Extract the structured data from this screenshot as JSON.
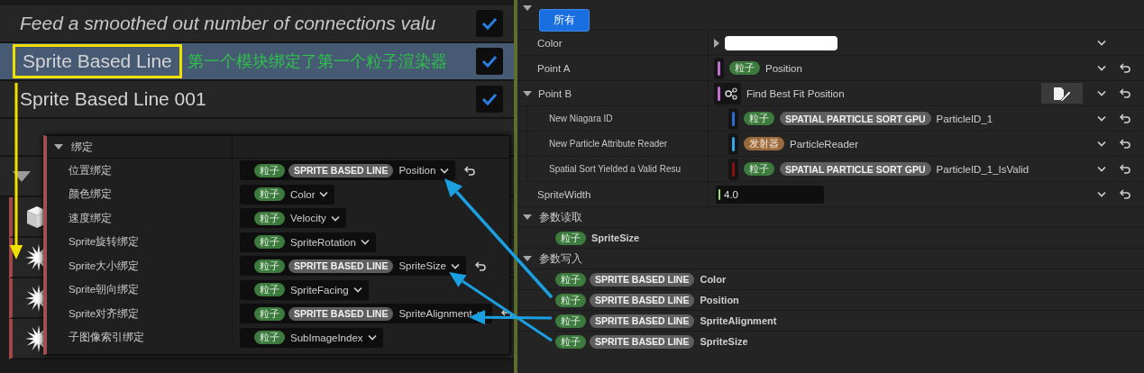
{
  "emitter_list": {
    "items": [
      {
        "text": "Feed a smoothed out number of connections valu",
        "kind": "comment",
        "selected": false,
        "checked": true,
        "annotated": false
      },
      {
        "text": "Sprite Based Line",
        "kind": "renderer",
        "selected": true,
        "checked": true,
        "annotated": true
      },
      {
        "text": "Sprite Based Line 001",
        "kind": "renderer",
        "selected": false,
        "checked": true,
        "annotated": false
      }
    ]
  },
  "annotation": {
    "note": "第一个模块绑定了第一个粒子渲染器"
  },
  "bindings_popup": {
    "title": "绑定",
    "expanded": true,
    "rows": [
      {
        "label": "位置绑定",
        "tags": [
          {
            "text": "粒子",
            "kind": "particle"
          },
          {
            "text": "SPRITE BASED LINE",
            "kind": "module"
          }
        ],
        "value": "Position",
        "reset": true
      },
      {
        "label": "颜色绑定",
        "tags": [
          {
            "text": "粒子",
            "kind": "particle"
          }
        ],
        "value": "Color",
        "reset": false
      },
      {
        "label": "速度绑定",
        "tags": [
          {
            "text": "粒子",
            "kind": "particle"
          }
        ],
        "value": "Velocity",
        "reset": false
      },
      {
        "label": "Sprite旋转绑定",
        "tags": [
          {
            "text": "粒子",
            "kind": "particle"
          }
        ],
        "value": "SpriteRotation",
        "reset": false
      },
      {
        "label": "Sprite大小绑定",
        "tags": [
          {
            "text": "粒子",
            "kind": "particle"
          },
          {
            "text": "SPRITE BASED LINE",
            "kind": "module"
          }
        ],
        "value": "SpriteSize",
        "reset": true
      },
      {
        "label": "Sprite朝向绑定",
        "tags": [
          {
            "text": "粒子",
            "kind": "particle"
          }
        ],
        "value": "SpriteFacing",
        "reset": false
      },
      {
        "label": "Sprite对齐绑定",
        "tags": [
          {
            "text": "粒子",
            "kind": "particle"
          },
          {
            "text": "SPRITE BASED LINE",
            "kind": "module"
          }
        ],
        "value": "SpriteAlignment",
        "reset": true
      },
      {
        "label": "子图像索引绑定",
        "tags": [
          {
            "text": "粒子",
            "kind": "particle"
          }
        ],
        "value": "SubImageIndex",
        "reset": false
      }
    ]
  },
  "details": {
    "filter": "所有",
    "expanded": true,
    "properties": [
      {
        "label": "Color",
        "kind": "color",
        "color": "#ffffff",
        "reset": false
      },
      {
        "label": "Point A",
        "kind": "binding",
        "color": "#c070d0",
        "tags": [
          {
            "text": "粒子",
            "kind": "particle"
          }
        ],
        "value": "Position",
        "reset": true
      },
      {
        "label": "Point B",
        "kind": "function",
        "color": "#c070d0",
        "value": "Find Best Fit Position",
        "expanded": true,
        "reset": true,
        "children": [
          {
            "label": "New Niagara ID",
            "kind": "binding",
            "color": "#2a6fd0",
            "tags": [
              {
                "text": "粒子",
                "kind": "particle"
              },
              {
                "text": "SPATIAL PARTICLE SORT GPU",
                "kind": "module"
              }
            ],
            "value": "ParticleID_1",
            "reset": true
          },
          {
            "label": "New Particle Attribute Reader",
            "kind": "binding",
            "color": "#30a8e8",
            "tags": [
              {
                "text": "发射器",
                "kind": "emitter"
              }
            ],
            "value": "ParticleReader",
            "reset": true
          },
          {
            "label": "Spatial Sort Yielded a Valid Resu",
            "kind": "binding",
            "color": "#8a1010",
            "tags": [
              {
                "text": "粒子",
                "kind": "particle"
              },
              {
                "text": "SPATIAL PARTICLE SORT GPU",
                "kind": "module"
              }
            ],
            "value": "ParticleID_1_IsValid",
            "reset": true
          }
        ]
      },
      {
        "label": "SpriteWidth",
        "kind": "number",
        "color": "#a0e070",
        "value": "4.0",
        "reset": true
      }
    ],
    "sections": [
      {
        "title": "参数读取",
        "expanded": true,
        "items": [
          {
            "tags": [
              {
                "text": "粒子",
                "kind": "particle"
              }
            ],
            "value": "SpriteSize"
          }
        ]
      },
      {
        "title": "参数写入",
        "expanded": true,
        "items": [
          {
            "tags": [
              {
                "text": "粒子",
                "kind": "particle"
              },
              {
                "text": "SPRITE BASED LINE",
                "kind": "module"
              }
            ],
            "value": "Color"
          },
          {
            "tags": [
              {
                "text": "粒子",
                "kind": "particle"
              },
              {
                "text": "SPRITE BASED LINE",
                "kind": "module"
              }
            ],
            "value": "Position"
          },
          {
            "tags": [
              {
                "text": "粒子",
                "kind": "particle"
              },
              {
                "text": "SPRITE BASED LINE",
                "kind": "module"
              }
            ],
            "value": "SpriteAlignment"
          },
          {
            "tags": [
              {
                "text": "粒子",
                "kind": "particle"
              },
              {
                "text": "SPRITE BASED LINE",
                "kind": "module"
              }
            ],
            "value": "SpriteSize"
          }
        ]
      }
    ]
  }
}
